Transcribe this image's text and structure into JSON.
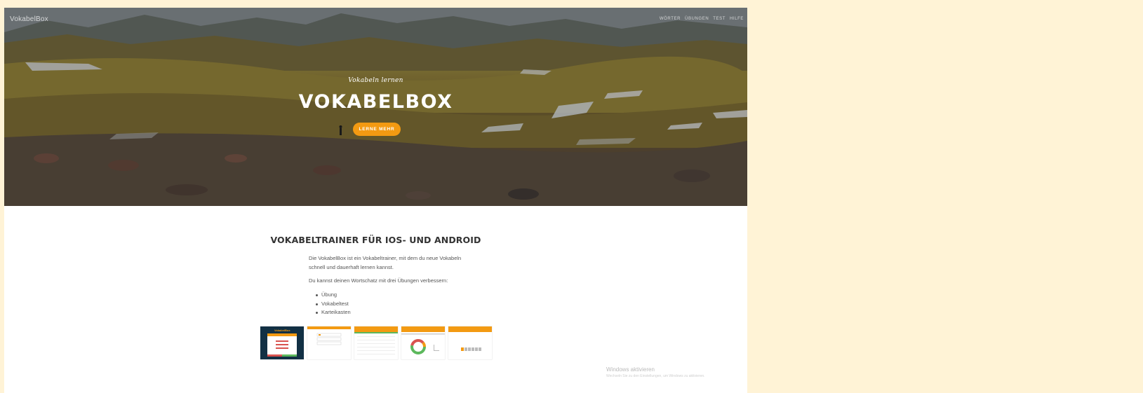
{
  "header": {
    "brand": "VokabelBox",
    "nav": [
      "WÖRTER",
      "ÜBUNGEN",
      "TEST",
      "HILFE"
    ]
  },
  "hero": {
    "tagline": "Vokabeln lernen",
    "title": "VOKABELBOX",
    "cta_label": "LERNE MEHR",
    "accent_color": "#f39a12"
  },
  "content": {
    "section_title": "VOKABELTRAINER FÜR IOS- UND ANDROID",
    "paragraph1": "Die VokabelBox ist ein Vokabeltrainer, mit dem du neue Vokabeln schnell und dauerhaft lernen kannst.",
    "paragraph2": "Du kannst deinen Wortschatz mit drei Übungen verbessern:",
    "bullets": [
      "Übung",
      "Vokabeltest",
      "Karteikasten"
    ]
  },
  "thumbnails": {
    "t1_title": "VokabelBox"
  },
  "watermark": {
    "line1": "Windows aktivieren",
    "line2": "Wechseln Sie zu den Einstellungen, um Windows zu aktivieren."
  }
}
